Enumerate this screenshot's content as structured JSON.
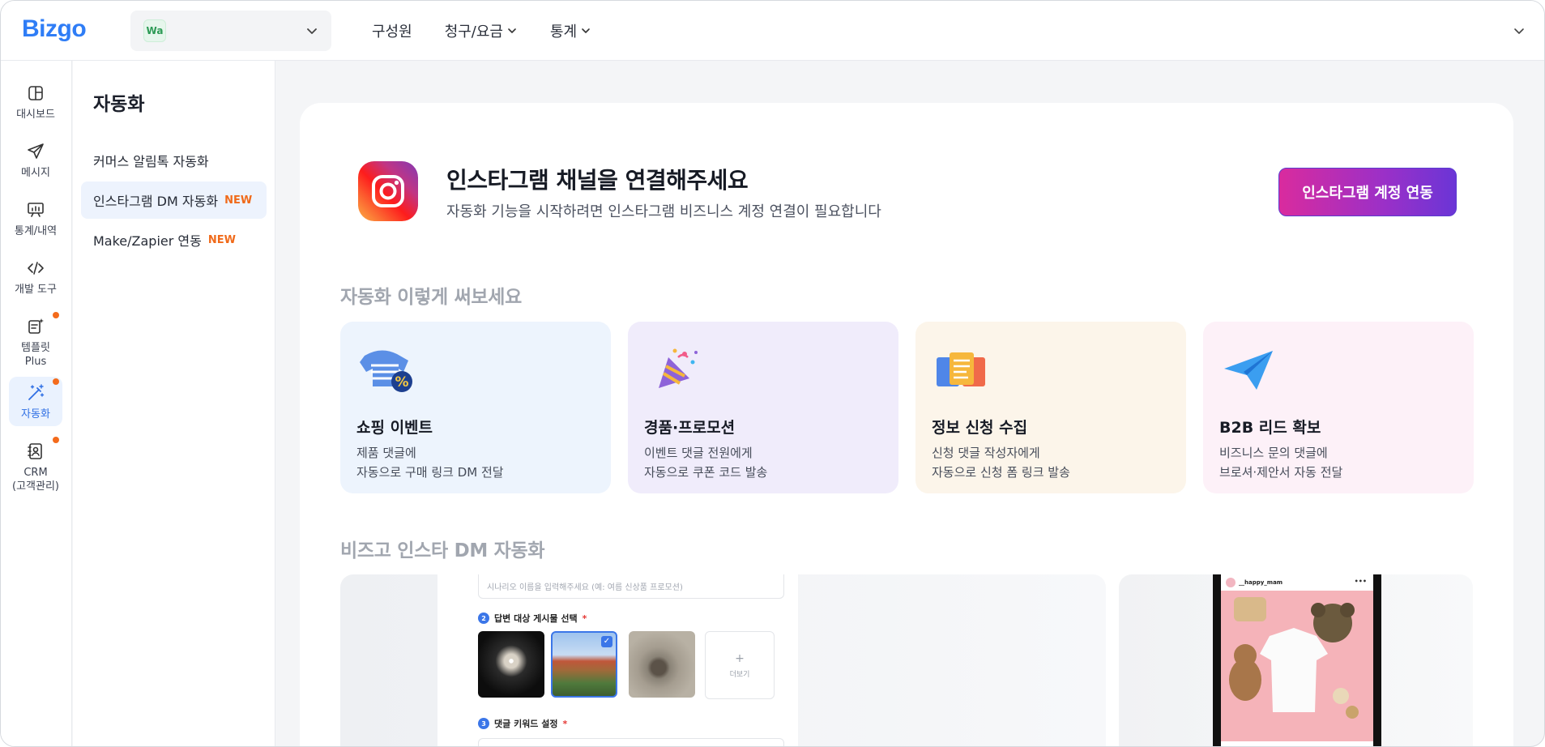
{
  "app": {
    "logo": "Bizgo"
  },
  "workspace": {
    "badge": "Wa"
  },
  "topnav": [
    {
      "label": "구성원",
      "has_menu": false
    },
    {
      "label": "청구/요금",
      "has_menu": true
    },
    {
      "label": "통계",
      "has_menu": true
    }
  ],
  "rail": {
    "dashboard": "대시보드",
    "message": "메시지",
    "stats": "통계/내역",
    "dev": "개발 도구",
    "template": "템플릿 Plus",
    "template_l1": "템플릿",
    "template_l2": "Plus",
    "automation": "자동화",
    "crm_l1": "CRM",
    "crm_l2": "(고객관리)"
  },
  "subnav": {
    "title": "자동화",
    "items": [
      {
        "label": "커머스 알림톡 자동화",
        "badge": ""
      },
      {
        "label": "인스타그램 DM 자동화",
        "badge": "NEW"
      },
      {
        "label": "Make/Zapier 연동",
        "badge": "NEW"
      }
    ]
  },
  "hero": {
    "title": "인스타그램 채널을 연결해주세요",
    "subtitle": "자동화 기능을 시작하려면 인스타그램 비즈니스 계정 연결이 필요합니다",
    "button": "인스타그램 계정 연동"
  },
  "sections": {
    "usecases": "자동화 이렇게 써보세요",
    "preview": "비즈고 인스타 DM 자동화"
  },
  "usecases": [
    {
      "title": "쇼핑 이벤트",
      "line1": "제품 댓글에",
      "line2": "자동으로 구매 링크 DM 전달",
      "bg": "#edf4fd",
      "icon": "shopping-tshirt-icon"
    },
    {
      "title": "경품·프로모션",
      "line1": "이벤트 댓글 전원에게",
      "line2": "자동으로 쿠폰 코드 발송",
      "bg": "#f0ecfb",
      "icon": "party-popper-icon"
    },
    {
      "title": "정보 신청 수집",
      "line1": "신청 댓글 작성자에게",
      "line2": "자동으로 신청 폼 링크 발송",
      "bg": "#fcf5ea",
      "icon": "documents-icon"
    },
    {
      "title": "B2B 리드 확보",
      "line1": "비즈니스 문의 댓글에",
      "line2": "브로셔·제안서 자동 전달",
      "bg": "#fdf1f8",
      "icon": "paper-plane-icon"
    }
  ],
  "preview_form": {
    "name_placeholder": "시나리오 이름을 입력해주세요 (예: 여름 신상품 프로모션)",
    "step2_num": "2",
    "step2_label": "답변 대상 게시물 선택",
    "step3_num": "3",
    "step3_label": "댓글 키워드 설정",
    "required_mark": "*",
    "more_label": "더보기",
    "more_plus": "+"
  },
  "preview_phone": {
    "username": "__happy_mam",
    "menu": "•••"
  }
}
